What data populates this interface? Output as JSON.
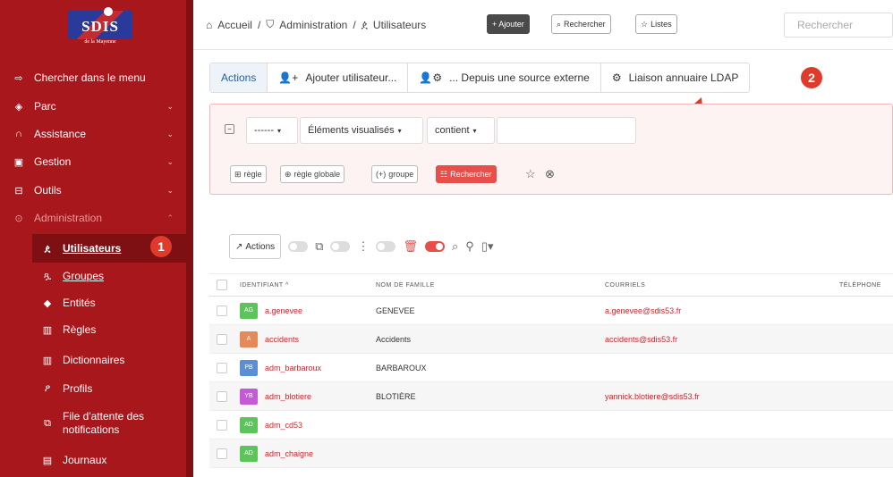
{
  "sidebar": {
    "logo_text": "SDIS",
    "logo_sub": "de la Mayenne",
    "items": [
      {
        "label": "Chercher dans le menu",
        "icon": "arrow-right-icon"
      },
      {
        "label": "Parc",
        "icon": "gamepad-icon"
      },
      {
        "label": "Assistance",
        "icon": "headset-icon"
      },
      {
        "label": "Gestion",
        "icon": "wallet-icon"
      },
      {
        "label": "Outils",
        "icon": "briefcase-icon"
      },
      {
        "label": "Administration",
        "icon": "shield-icon"
      }
    ],
    "sub_items": [
      {
        "label": "Utilisateurs",
        "icon": "user-icon"
      },
      {
        "label": "Groupes",
        "icon": "users-icon"
      },
      {
        "label": "Entités",
        "icon": "layers-icon"
      },
      {
        "label": "Règles",
        "icon": "book-icon"
      },
      {
        "label": "Dictionnaires",
        "icon": "book-open-icon"
      },
      {
        "label": "Profils",
        "icon": "user-check-icon"
      },
      {
        "label": "File d'attente des notifications",
        "icon": "bell-plus-icon"
      },
      {
        "label": "Journaux",
        "icon": "news-icon"
      }
    ]
  },
  "badges": {
    "one": "1",
    "two": "2"
  },
  "topbar": {
    "breadcrumb": [
      "Accueil",
      "Administration",
      "Utilisateurs"
    ],
    "add_label": "+ Ajouter",
    "search_label": "Rechercher",
    "lists_label": "Listes",
    "search_placeholder": "Rechercher"
  },
  "actions": {
    "tabs": [
      "Actions",
      "Ajouter utilisateur...",
      "... Depuis une source externe",
      "Liaison annuaire LDAP"
    ]
  },
  "filter": {
    "field1": "------",
    "field2": "Éléments visualisés",
    "field3": "contient",
    "btn_rule": "règle",
    "btn_global_rule": "règle globale",
    "btn_group": "groupe",
    "btn_search": "Rechercher"
  },
  "toolbar": {
    "actions_label": "Actions"
  },
  "table": {
    "headers": [
      "IDENTIFIANT",
      "NOM DE FAMILLE",
      "COURRIELS",
      "TÉLÉPHONE"
    ],
    "rows": [
      {
        "initials": "AG",
        "color": "#5cc45a",
        "ident": "a.genevee",
        "nom": "GENEVEE",
        "mail": "a.genevee@sdis53.fr"
      },
      {
        "initials": "A",
        "color": "#e3895a",
        "ident": "accidents",
        "nom": "Accidents",
        "mail": "accidents@sdis53.fr"
      },
      {
        "initials": "PB",
        "color": "#5a8fd6",
        "ident": "adm_barbaroux",
        "nom": "BARBAROUX",
        "mail": ""
      },
      {
        "initials": "YB",
        "color": "#c45ad6",
        "ident": "adm_blotiere",
        "nom": "BLOTIÈRE",
        "mail": "yannick.blotiere@sdis53.fr"
      },
      {
        "initials": "AD",
        "color": "#5cc45a",
        "ident": "adm_cd53",
        "nom": "",
        "mail": ""
      },
      {
        "initials": "AD",
        "color": "#5cc45a",
        "ident": "adm_chaigne",
        "nom": "",
        "mail": ""
      }
    ]
  }
}
